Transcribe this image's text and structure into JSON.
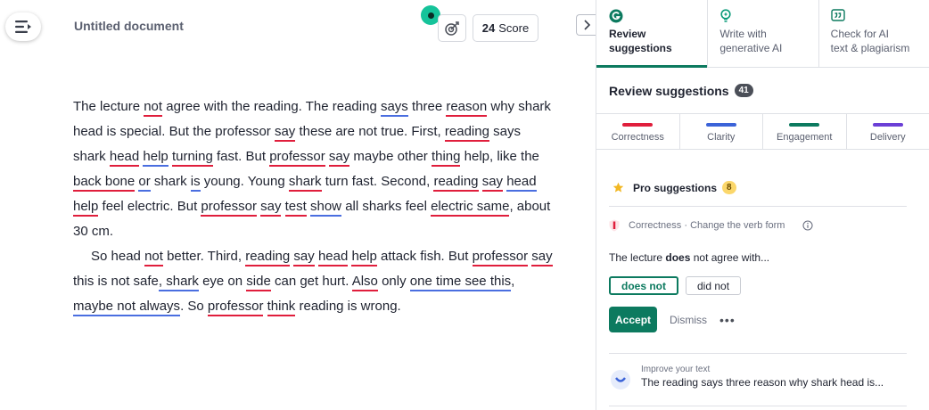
{
  "editor": {
    "doc_title": "Untitled document",
    "score_value": "24",
    "score_label": "Score",
    "paragraph1": [
      {
        "t": "The lecture "
      },
      {
        "t": "not",
        "u": "r"
      },
      {
        "t": " agree with the reading. The reading "
      },
      {
        "t": "says",
        "u": "b"
      },
      {
        "t": " three "
      },
      {
        "t": "reason",
        "u": "r"
      },
      {
        "t": " why shark head is special. But the professor "
      },
      {
        "t": "say",
        "u": "r"
      },
      {
        "t": " these are not true. First, "
      },
      {
        "t": "reading",
        "u": "r"
      },
      {
        "t": " says shark "
      },
      {
        "t": "head",
        "u": "r"
      },
      {
        "t": " "
      },
      {
        "t": "help",
        "u": "b"
      },
      {
        "t": " "
      },
      {
        "t": "turning",
        "u": "r"
      },
      {
        "t": " fast. But "
      },
      {
        "t": "professor",
        "u": "r"
      },
      {
        "t": " "
      },
      {
        "t": "say",
        "u": "r"
      },
      {
        "t": " maybe other "
      },
      {
        "t": "thing",
        "u": "r"
      },
      {
        "t": " help, like the "
      },
      {
        "t": "back bone",
        "u": "r"
      },
      {
        "t": " "
      },
      {
        "t": "or",
        "u": "b"
      },
      {
        "t": " shark "
      },
      {
        "t": "is",
        "u": "b"
      },
      {
        "t": " young. Young "
      },
      {
        "t": "shark",
        "u": "r"
      },
      {
        "t": " turn fast. Second, "
      },
      {
        "t": "reading",
        "u": "r"
      },
      {
        "t": " "
      },
      {
        "t": "say",
        "u": "r"
      },
      {
        "t": " "
      },
      {
        "t": "head",
        "u": "b"
      },
      {
        "t": " "
      },
      {
        "t": "help",
        "u": "r"
      },
      {
        "t": " feel electric. But "
      },
      {
        "t": "professor",
        "u": "r"
      },
      {
        "t": " "
      },
      {
        "t": "say",
        "u": "r"
      },
      {
        "t": " "
      },
      {
        "t": "test",
        "u": "r"
      },
      {
        "t": " "
      },
      {
        "t": "show",
        "u": "b"
      },
      {
        "t": " all sharks feel "
      },
      {
        "t": "electric same",
        "u": "r"
      },
      {
        "t": ", about 30 cm."
      }
    ],
    "paragraph2": [
      {
        "t": "So head "
      },
      {
        "t": "not",
        "u": "r"
      },
      {
        "t": " better. Third, "
      },
      {
        "t": "reading",
        "u": "r"
      },
      {
        "t": " "
      },
      {
        "t": "say",
        "u": "r"
      },
      {
        "t": " "
      },
      {
        "t": "head",
        "u": "r"
      },
      {
        "t": " "
      },
      {
        "t": "help",
        "u": "r"
      },
      {
        "t": " attack fish. But "
      },
      {
        "t": "professor",
        "u": "r"
      },
      {
        "t": " "
      },
      {
        "t": "say",
        "u": "r"
      },
      {
        "t": " this is not safe"
      },
      {
        "t": ", shark",
        "u": "b"
      },
      {
        "t": " eye on "
      },
      {
        "t": "side",
        "u": "r"
      },
      {
        "t": " can get hurt. "
      },
      {
        "t": "Also",
        "u": "r"
      },
      {
        "t": " only "
      },
      {
        "t": "one time see this",
        "u": "b"
      },
      {
        "t": ", "
      },
      {
        "t": "maybe not always",
        "u": "b"
      },
      {
        "t": ". So "
      },
      {
        "t": "professor",
        "u": "r"
      },
      {
        "t": " "
      },
      {
        "t": "think",
        "u": "r"
      },
      {
        "t": " reading is wrong."
      }
    ]
  },
  "sidebar": {
    "tabs": [
      {
        "line1": "Review",
        "line2": "suggestions",
        "icon": "grammarly-logo-icon"
      },
      {
        "line1": "Write with",
        "line2": "generative AI",
        "icon": "lightbulb-icon"
      },
      {
        "line1": "Check for AI",
        "line2": "text & plagiarism",
        "icon": "quote-icon"
      }
    ],
    "review_title": "Review suggestions",
    "review_count": "41",
    "categories": [
      {
        "label": "Correctness",
        "color": "#e01e3c"
      },
      {
        "label": "Clarity",
        "color": "#3b63d8"
      },
      {
        "label": "Engagement",
        "color": "#0c7a5f"
      },
      {
        "label": "Delivery",
        "color": "#6b3fd6"
      }
    ],
    "pro_label": "Pro suggestions",
    "pro_count": "8",
    "card": {
      "category": "Correctness · Change the verb form",
      "text_before": "The lecture ",
      "text_bold": "does",
      "text_after": " not agree with...",
      "option_primary": "does not",
      "option_secondary": "did not",
      "accept_label": "Accept",
      "dismiss_label": "Dismiss",
      "more_label": "•••"
    },
    "improve": {
      "label": "Improve your text",
      "preview": "The reading says three reason why shark head is..."
    }
  }
}
